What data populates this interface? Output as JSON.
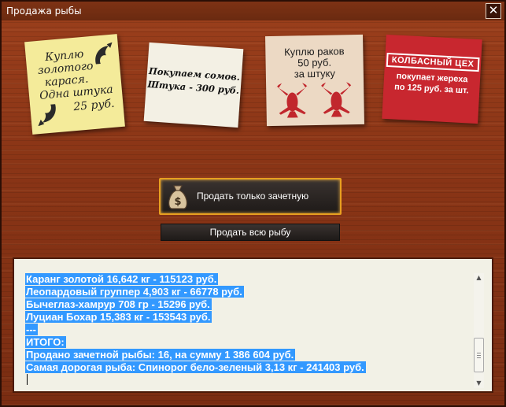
{
  "window": {
    "title": "Продажа рыбы",
    "close_label": "✕"
  },
  "notes": {
    "goldfish": {
      "line1": "Куплю",
      "line2": "золотого",
      "line3": "карася.",
      "line4": "Одна штука",
      "line5": "25 руб."
    },
    "catfish": {
      "line1": "Покупаем сомов.",
      "line2": "Штука - 300 руб."
    },
    "crayfish": {
      "line1": "Куплю раков",
      "line2": "50 руб.",
      "line3": "за штуку"
    },
    "sausage": {
      "brand": "КОЛБАСНЫЙ ЦЕХ",
      "line1": "покупает жереха",
      "line2": "по 125 руб. за шт."
    }
  },
  "buttons": {
    "sell_qualifying": "Продать только зачетную",
    "sell_all": "Продать всю рыбу"
  },
  "log": {
    "lines": [
      "Каранг золотой 16,642 кг - 115123 руб.",
      "Леопардовый группер 4,903 кг - 66778 руб.",
      "Бычеглаз-хамрур 708 гр - 15296 руб.",
      "Луциан Бохар 15,383 кг - 153543 руб.",
      "---",
      "ИТОГО:",
      "Продано зачетной рыбы: 16, на сумму 1 386 604 руб.",
      "Самая дорогая рыба: Спинорог бело-зеленый 3,13 кг - 241403 руб."
    ]
  },
  "colors": {
    "selection": "#3399ff",
    "button_border_active": "#e8a020",
    "sausage_note": "#c8272f"
  },
  "icons": {
    "close": "close-icon",
    "money_bag": "money-bag-icon",
    "scroll_up": "chevron-up-icon",
    "scroll_down": "chevron-down-icon"
  }
}
